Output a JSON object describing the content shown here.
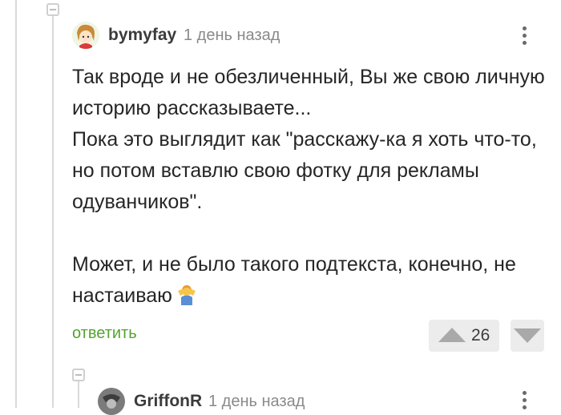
{
  "comment": {
    "username": "bymyfay",
    "time": "1 день назад",
    "paragraphs": [
      "Так вроде и не обезличенный, Вы же свою личную историю рассказываете...",
      "Пока это выглядит как \"расскажу-ка я хоть что-то, но потом вставлю свою фотку для рекламы одуванчиков\"."
    ],
    "paragraph3": "Может, и не было такого подтекста, конечно, не настаиваю",
    "emoji": "person-shrugging-emoji",
    "reply_label": "ответить",
    "rating": "26"
  },
  "reply": {
    "username": "GriffonR",
    "time": "1 день назад"
  },
  "icons": {
    "collapse": "collapse-thread-icon",
    "more": "more-vertical-icon",
    "upvote": "upvote-arrow-icon",
    "downvote": "downvote-arrow-icon"
  },
  "colors": {
    "reply_link": "#53a32f",
    "vote_bg": "#ececec"
  }
}
